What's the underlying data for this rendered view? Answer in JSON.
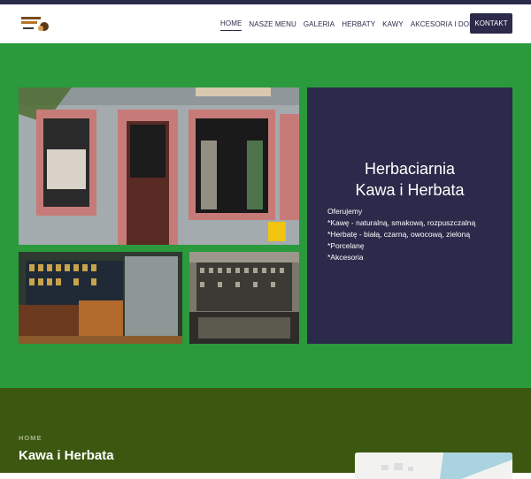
{
  "header": {
    "logo_alt": "Kawa i Herbata logo",
    "nav": [
      {
        "label": "HOME",
        "active": true
      },
      {
        "label": "NASZE MENU"
      },
      {
        "label": "GALERIA"
      },
      {
        "label": "HERBATY"
      },
      {
        "label": "KAWY"
      },
      {
        "label": "AKCESORIA I DODATKI"
      }
    ],
    "contact_label": "KONTAKT"
  },
  "hero": {
    "title_line1": "Herbaciarnia",
    "title_line2": "Kawa i Herbata",
    "offer": [
      "Oferujemy",
      "*Kawę - naturalną, smakową, rozpuszczalną",
      "*Herbatę - białą, czarną, owocową, zieloną",
      "*Porcelanę",
      "*Akcesoria"
    ]
  },
  "page": {
    "breadcrumb": "HOME",
    "title": "Kawa i Herbata"
  },
  "colors": {
    "accent": "#2c2a4a",
    "hero_bg": "#2a9a3c",
    "lower_bg": "#3c5810"
  }
}
